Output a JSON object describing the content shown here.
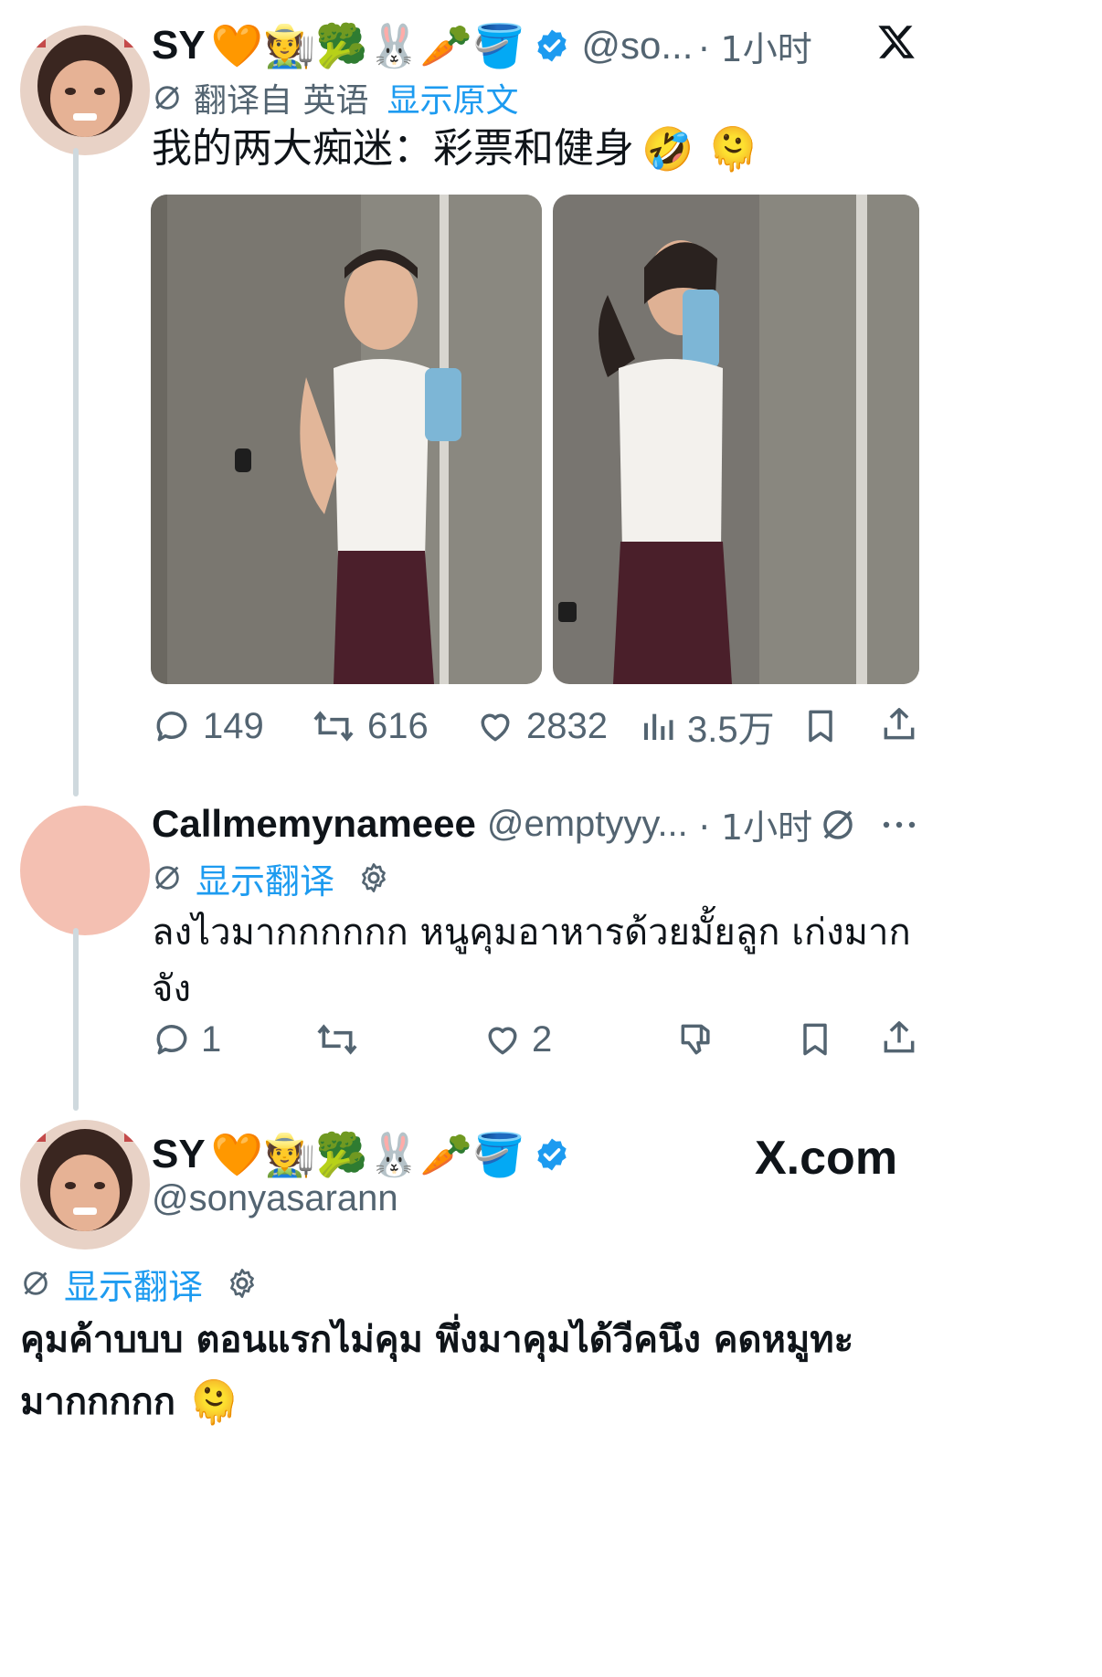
{
  "tweet1": {
    "name": "SY",
    "name_emojis": "🧡🧑‍🌾🥦🐰🥕🪣",
    "handle": "@so...",
    "time": "· 1小时",
    "translated_from": "翻译自 英语",
    "show_original": "显示原文",
    "text": "我的两大痴迷：彩票和健身",
    "text_emojis": "🤣 🫠",
    "stats": {
      "replies": "149",
      "retweets": "616",
      "likes": "2832",
      "views": "3.5万"
    }
  },
  "reply": {
    "name": "Callmemynameee",
    "handle": "@emptyyy...",
    "time": "· 1小时",
    "show_translation": "显示翻译",
    "text_line1": "ลงไวมากกกกกก หนูคุมอาหารด้วยมั้ยลูก เก่งมาก",
    "text_line2": "จัง",
    "stats": {
      "replies": "1",
      "likes": "2"
    }
  },
  "tweet2": {
    "name": "SY",
    "name_emojis": "🧡🧑‍🌾🥦🐰🥕🪣",
    "handle": "@sonyasarann",
    "brand": "X.com",
    "show_translation": "显示翻译",
    "text_line1": "คุมค้าบบบ ตอนแรกไม่คุม พึ่งมาคุมได้วีคนึง คดหมูทะ",
    "text_line2": "มากกกกก",
    "text_emoji": "🫠"
  },
  "colors": {
    "accent": "#1d9bf0",
    "muted": "#536471",
    "line": "#cfd9de"
  }
}
